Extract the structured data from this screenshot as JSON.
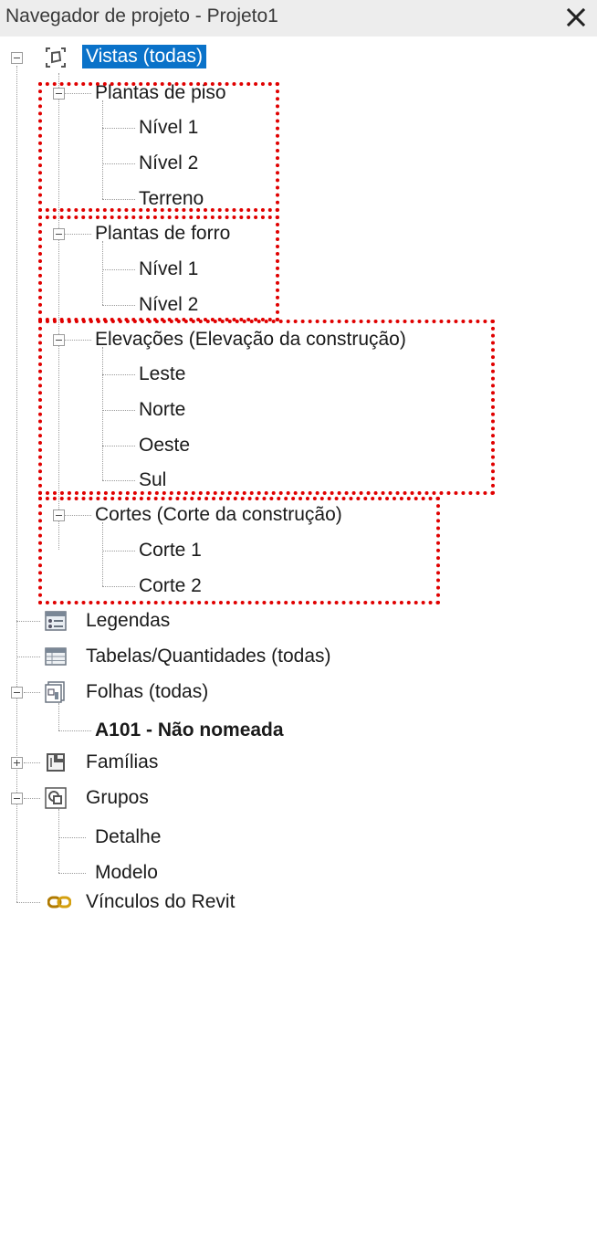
{
  "window": {
    "title": "Navegador de projeto - Projeto1",
    "close_symbol": "✕"
  },
  "tree": {
    "views": {
      "label": "Vistas (todas)",
      "icon": "views-icon",
      "selected": true,
      "floor_plans": {
        "label": "Plantas de piso",
        "items": [
          "Nível 1",
          "Nível 2",
          "Terreno"
        ]
      },
      "ceiling_plans": {
        "label": "Plantas de forro",
        "items": [
          "Nível 1",
          "Nível 2"
        ]
      },
      "elevations": {
        "label": "Elevações (Elevação da construção)",
        "items": [
          "Leste",
          "Norte",
          "Oeste",
          "Sul"
        ]
      },
      "sections": {
        "label": "Cortes (Corte da construção)",
        "items": [
          "Corte 1",
          "Corte 2"
        ]
      }
    },
    "legends": {
      "label": "Legendas",
      "icon": "legend-icon"
    },
    "schedules": {
      "label": "Tabelas/Quantidades (todas)",
      "icon": "schedule-icon"
    },
    "sheets": {
      "label": "Folhas (todas)",
      "icon": "sheet-icon",
      "items": [
        "A101 - Não nomeada"
      ]
    },
    "families": {
      "label": "Famílias",
      "icon": "families-icon"
    },
    "groups": {
      "label": "Grupos",
      "icon": "groups-icon",
      "items": [
        "Detalhe",
        "Modelo"
      ]
    },
    "revit_links": {
      "label": "Vínculos do Revit",
      "icon": "revit-link-icon"
    }
  },
  "colors": {
    "selection": "#0a72c9",
    "highlight_dots": "#e00000",
    "titlebar": "#ededed"
  }
}
